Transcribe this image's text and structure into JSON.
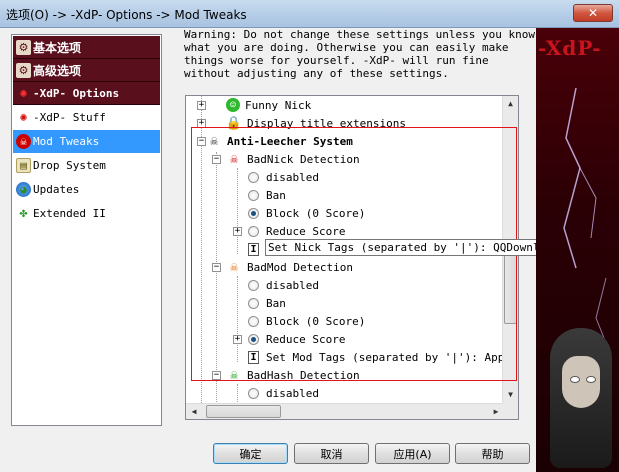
{
  "window": {
    "title": "选项(O) -> -XdP- Options -> Mod Tweaks",
    "close_label": "✕"
  },
  "nav": {
    "items": [
      {
        "label": "基本选项",
        "icon": "gears-icon"
      },
      {
        "label": "高级选项",
        "icon": "gears-icon"
      },
      {
        "label": "-XdP- Options",
        "icon": "xdp-logo-icon"
      },
      {
        "label": "-XdP- Stuff",
        "icon": "xdp-logo-icon"
      },
      {
        "label": "Mod Tweaks",
        "icon": "skull-icon"
      },
      {
        "label": "Drop System",
        "icon": "drop-icon"
      },
      {
        "label": "Updates",
        "icon": "globe-icon"
      },
      {
        "label": "Extended II",
        "icon": "puzzle-icon"
      }
    ]
  },
  "warning": "Warning: Do not change these settings unless you know\nwhat you are doing. Otherwise you can easily make\nthings worse for yourself. -XdP- will run fine\nwithout adjusting any of these settings.",
  "tree": {
    "funny_nick": "Funny Nick",
    "display_title": "Display title extensions",
    "anti_leecher": "Anti-Leecher System",
    "badnick": {
      "label": "BadNick Detection",
      "options": [
        "disabled",
        "Ban",
        "Block (0 Score)",
        "Reduce Score"
      ],
      "set_tags": "Set Nick Tags (separated by '|'): QQDownload|shaohan|yourname|xunlei"
    },
    "badmod": {
      "label": "BadMod Detection",
      "options": [
        "disabled",
        "Ban",
        "Block (0 Score)",
        "Reduce Score"
      ],
      "set_tags": "Set Mod Tags (separated by '|'): Applejuice"
    },
    "badhash": {
      "label": "BadHash Detection",
      "options": [
        "disabled"
      ]
    }
  },
  "side_art": {
    "logo": "-XdP-"
  },
  "buttons": {
    "ok": "确定",
    "cancel": "取消",
    "apply": "应用(A)",
    "help": "帮助"
  }
}
